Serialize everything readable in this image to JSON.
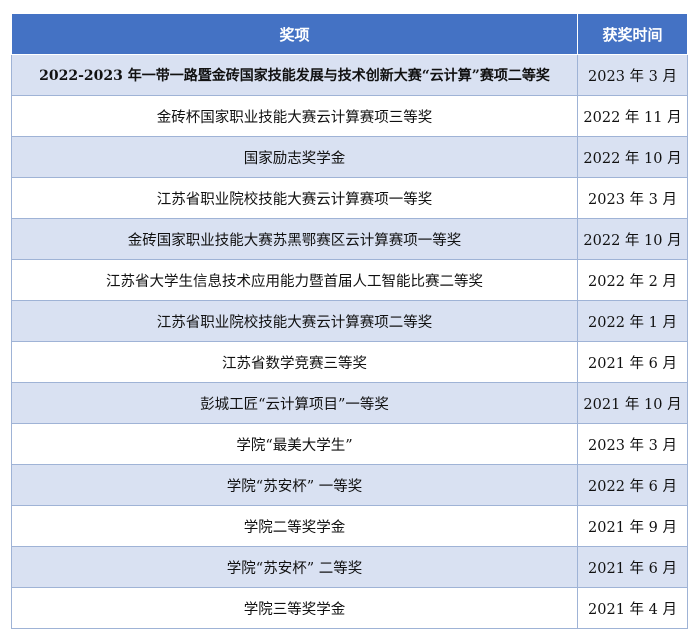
{
  "table": {
    "headers": {
      "award": "奖项",
      "time": "获奖时间"
    },
    "rows": [
      {
        "award": "2022-2023 年一带一路暨金砖国家技能发展与技术创新大赛“云计算”赛项二等奖",
        "time": "2023 年 3 月"
      },
      {
        "award": "金砖杯国家职业技能大赛云计算赛项三等奖",
        "time": "2022 年 11 月"
      },
      {
        "award": "国家励志奖学金",
        "time": "2022 年 10 月"
      },
      {
        "award": "江苏省职业院校技能大赛云计算赛项一等奖",
        "time": "2023 年 3 月"
      },
      {
        "award": "金砖国家职业技能大赛苏黑鄂赛区云计算赛项一等奖",
        "time": "2022 年 10 月"
      },
      {
        "award": "江苏省大学生信息技术应用能力暨首届人工智能比赛二等奖",
        "time": "2022 年 2 月"
      },
      {
        "award": "江苏省职业院校技能大赛云计算赛项二等奖",
        "time": "2022 年 1 月"
      },
      {
        "award": "江苏省数学竞赛三等奖",
        "time": "2021 年 6 月"
      },
      {
        "award": "彭城工匠“云计算项目”一等奖",
        "time": "2021 年 10 月"
      },
      {
        "award": "学院“最美大学生”",
        "time": "2023 年 3 月"
      },
      {
        "award": "学院“苏安杯” 一等奖",
        "time": "2022 年 6 月"
      },
      {
        "award": "学院二等奖学金",
        "time": "2021 年 9 月"
      },
      {
        "award": "学院“苏安杯” 二等奖",
        "time": "2021 年 6 月"
      },
      {
        "award": "学院三等奖学金",
        "time": "2021 年 4 月"
      }
    ]
  },
  "colors": {
    "header_background": "#4472c4",
    "header_text": "#ffffff",
    "stripe_row": "#d9e1f2",
    "plain_row": "#ffffff",
    "border": "#9fb3d6"
  }
}
